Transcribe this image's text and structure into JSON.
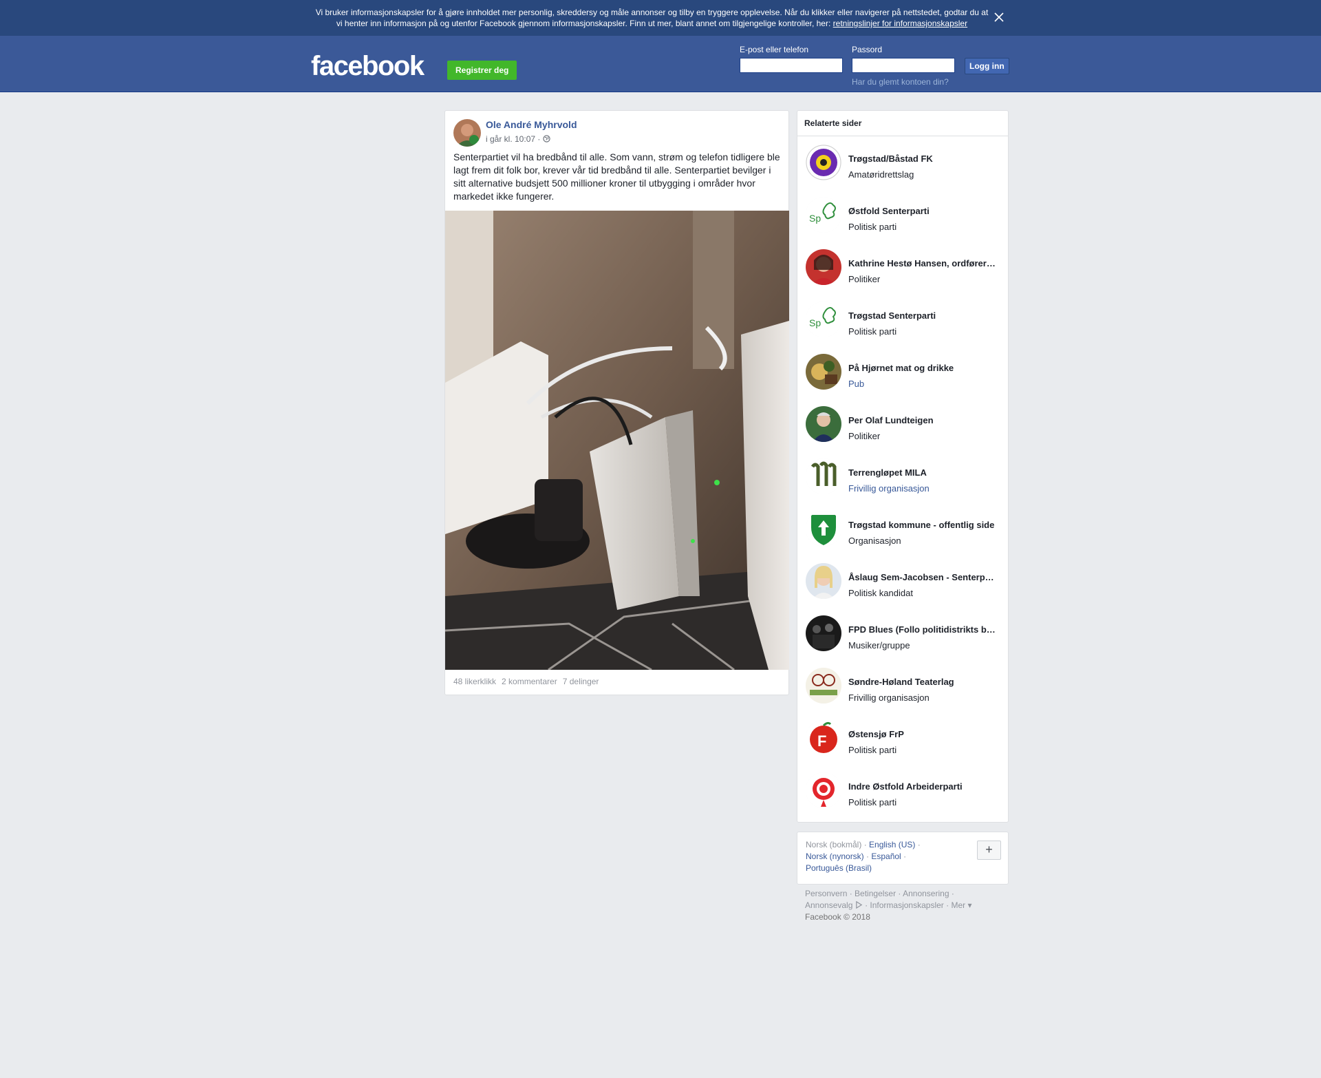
{
  "cookie_banner": {
    "text": "Vi bruker informasjonskapsler for å gjøre innholdet mer personlig, skreddersy og måle annonser og tilby en tryggere opplevelse. Når du klikker eller navigerer på nettstedet, godtar du at vi henter inn informasjon på og utenfor Facebook gjennom informasjonskapsler. Finn ut mer, blant annet om tilgjengelige kontroller, her: ",
    "link": "retningslinjer for informasjonskapsler",
    "close_icon": "close-icon"
  },
  "header": {
    "logo": "facebook",
    "register_label": "Registrer deg",
    "email_label": "E-post eller telefon",
    "password_label": "Passord",
    "login_label": "Logg inn",
    "forgot_link": "Har du glemt kontoen din?",
    "email_value": "",
    "password_value": ""
  },
  "post": {
    "author": "Ole André Myhrvold",
    "time": "i går kl. 10:07 · ",
    "privacy_icon": "globe-icon",
    "text": "Senterpartiet vil ha bredbånd til alle. Som vann, strøm og telefon tidligere ble lagt frem dit folk bor, krever vår tid bredbånd til alle. Senterpartiet bevilger i sitt alternative budsjett 500 millioner kroner til utbygging i områder hvor markedet ikke fungerer.",
    "likes": "48 likerklikk",
    "comments": "2 kommentarer",
    "shares": "7 delinger"
  },
  "related": {
    "title": "Relaterte sider",
    "items": [
      {
        "name": "Trøgstad/Båstad FK",
        "category": "Amatøridrettslag",
        "link": false
      },
      {
        "name": "Østfold Senterparti",
        "category": "Politisk parti",
        "link": false
      },
      {
        "name": "Kathrine Hestø Hansen, ordfører…",
        "category": "Politiker",
        "link": false
      },
      {
        "name": "Trøgstad Senterparti",
        "category": "Politisk parti",
        "link": false
      },
      {
        "name": "På Hjørnet mat og drikke",
        "category": "Pub",
        "link": true
      },
      {
        "name": "Per Olaf Lundteigen",
        "category": "Politiker",
        "link": false
      },
      {
        "name": "Terrengløpet MILA",
        "category": "Frivillig organisasjon",
        "link": true
      },
      {
        "name": "Trøgstad kommune - offentlig side",
        "category": "Organisasjon",
        "link": false
      },
      {
        "name": "Åslaug Sem-Jacobsen - Senterp…",
        "category": "Politisk kandidat",
        "link": false
      },
      {
        "name": "FPD Blues (Follo politidistrikts b…",
        "category": "Musiker/gruppe",
        "link": false
      },
      {
        "name": "Søndre-Høland Teaterlag",
        "category": "Frivillig organisasjon",
        "link": false
      },
      {
        "name": "Østensjø FrP",
        "category": "Politisk parti",
        "link": false
      },
      {
        "name": "Indre Østfold Arbeiderparti",
        "category": "Politisk parti",
        "link": false
      }
    ]
  },
  "languages": {
    "current": "Norsk (bokmål)",
    "others": [
      "English (US)",
      "Norsk (nynorsk)",
      "Español",
      "Português (Brasil)"
    ],
    "plus": "+"
  },
  "footer": {
    "links": [
      "Personvern",
      "Betingelser",
      "Annonsering",
      "Annonsevalg",
      "Informasjonskapsler",
      "Mer"
    ],
    "copyright": "Facebook © 2018"
  }
}
